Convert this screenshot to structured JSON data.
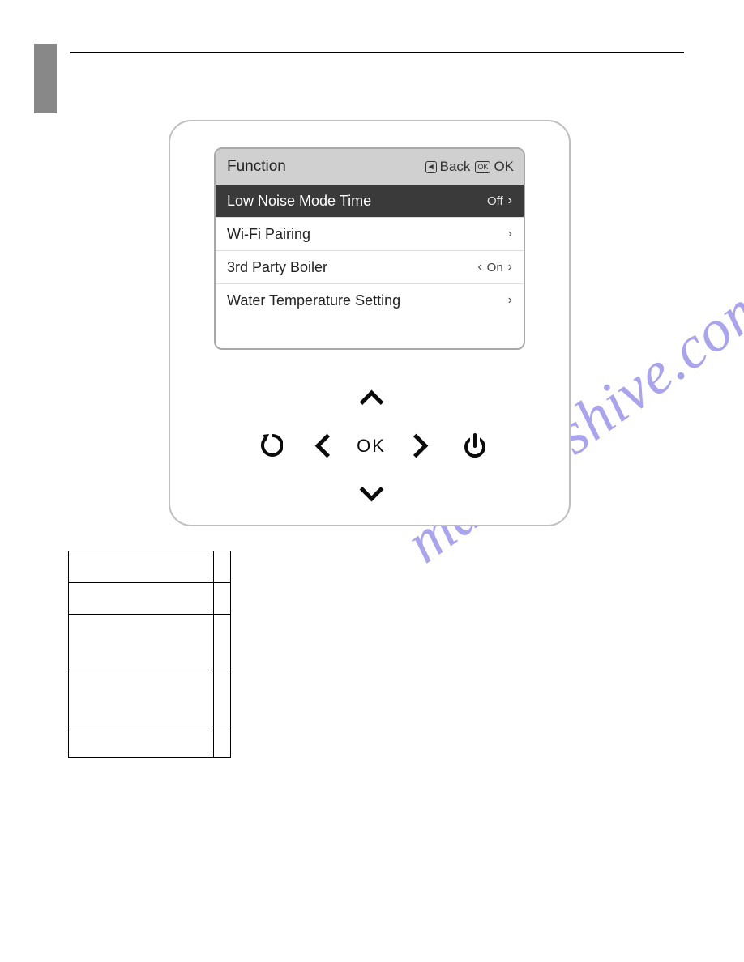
{
  "watermark": "manualshive.com",
  "screen": {
    "title": "Function",
    "header_back": "Back",
    "header_ok": "OK",
    "header_back_glyph": "▸",
    "header_ok_glyph": "OK",
    "rows": [
      {
        "label": "Low Noise Mode Time",
        "value": "Off",
        "selected": true,
        "has_left_chev": false,
        "has_right_chev": true
      },
      {
        "label": "Wi-Fi Pairing",
        "value": "",
        "selected": false,
        "has_left_chev": false,
        "has_right_chev": true
      },
      {
        "label": "3rd Party Boiler",
        "value": "On",
        "selected": false,
        "has_left_chev": true,
        "has_right_chev": true
      },
      {
        "label": "Water Temperature Setting",
        "value": "",
        "selected": false,
        "has_left_chev": false,
        "has_right_chev": true
      }
    ]
  },
  "controls": {
    "ok_label": "OK"
  },
  "table": {
    "rows": [
      {
        "a": "",
        "b": ""
      },
      {
        "a": "",
        "b": ""
      },
      {
        "a": "",
        "b": ""
      },
      {
        "a": "",
        "b": ""
      },
      {
        "a": "",
        "b": ""
      }
    ]
  }
}
